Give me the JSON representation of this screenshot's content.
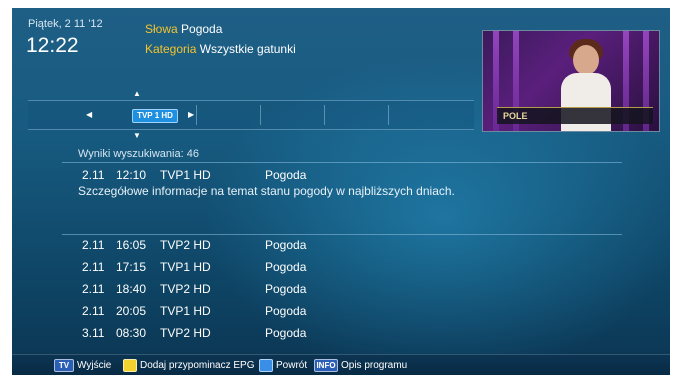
{
  "header": {
    "date": "Piątek, 2 11 '12",
    "time": "12:22",
    "query_label": "Słowa",
    "query_value": "Pogoda",
    "category_label": "Kategoria",
    "category_value": "Wszystkie gatunki"
  },
  "preview": {
    "overlay_text": "POLE"
  },
  "channel_selector": {
    "logo_text": "TVP 1 HD"
  },
  "results": {
    "count_text": "Wyniki wyszukiwania: 46",
    "selected": {
      "date": "2.11",
      "time": "12:10",
      "channel": "TVP1 HD",
      "title": "Pogoda",
      "description": "Szczegółowe informacje na temat stanu pogody w najbliższych dniach."
    },
    "rows": [
      {
        "date": "2.11",
        "time": "16:05",
        "channel": "TVP2 HD",
        "title": "Pogoda"
      },
      {
        "date": "2.11",
        "time": "17:15",
        "channel": "TVP1 HD",
        "title": "Pogoda"
      },
      {
        "date": "2.11",
        "time": "18:40",
        "channel": "TVP2 HD",
        "title": "Pogoda"
      },
      {
        "date": "2.11",
        "time": "20:05",
        "channel": "TVP1 HD",
        "title": "Pogoda"
      },
      {
        "date": "3.11",
        "time": "08:30",
        "channel": "TVP2 HD",
        "title": "Pogoda"
      }
    ]
  },
  "footer": {
    "tv_key": "TV",
    "exit_label": "Wyjście",
    "reminder_label": "Dodaj przypominacz EPG",
    "back_label": "Powrót",
    "info_key": "INFO",
    "info_label": "Opis programu"
  },
  "colors": {
    "accent_yellow": "#f2c52c",
    "background_blue": "#175a80",
    "key_yellow": "#f2d22e",
    "key_blue": "#3a8ee6"
  }
}
